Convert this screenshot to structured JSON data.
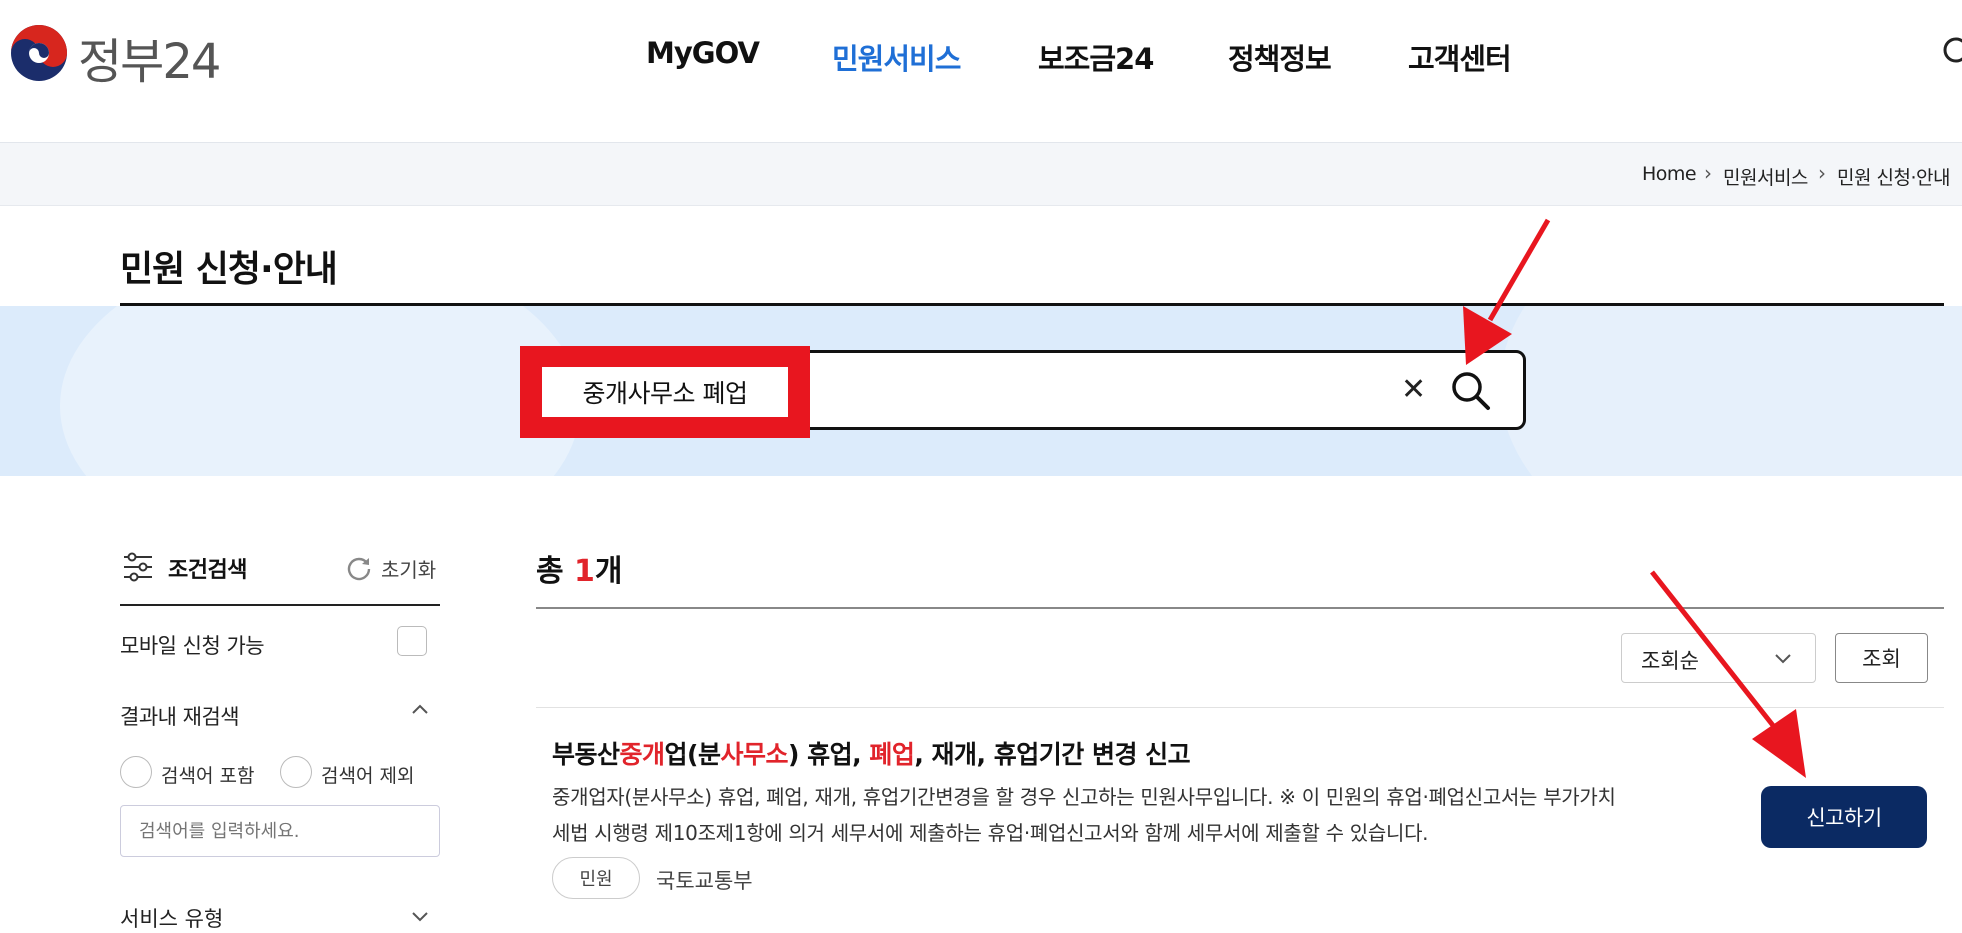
{
  "header": {
    "logo_text": "정부24",
    "nav": [
      "MyGOV",
      "민원서비스",
      "보조금24",
      "정책정보",
      "고객센터"
    ],
    "active_nav": "민원서비스"
  },
  "breadcrumb": [
    "Home",
    "민원서비스",
    "민원 신청·안내"
  ],
  "page_title": "민원 신청·안내",
  "search": {
    "query": "중개사무소 폐업",
    "clear_symbol": "✕"
  },
  "sidebar": {
    "filter_title": "조건검색",
    "reset_label": "초기화",
    "mobile_label": "모바일 신청 가능",
    "refine_label": "결과내 재검색",
    "include_label": "검색어 포함",
    "exclude_label": "검색어 제외",
    "refine_placeholder": "검색어를 입력하세요.",
    "service_type_label": "서비스 유형"
  },
  "results": {
    "total_prefix": "총 ",
    "total_count": "1",
    "total_suffix": "개",
    "sort_value": "조회순",
    "query_button": "조회",
    "item": {
      "title_parts": [
        "부동산",
        "중개",
        "업(분",
        "사무소",
        ") 휴업, ",
        "폐업",
        ", 재개, 휴업기간 변경 신고"
      ],
      "desc_line1": "중개업자(분사무소) 휴업, 폐업, 재개, 휴업기간변경을 할 경우 신고하는 민원사무입니다. ※ 이 민원의 휴업·폐업신고서는 부가가치",
      "desc_line2": "세법 시행령 제10조제1항에 의거 세무서에 제출하는 휴업·폐업신고서와 함께 세무서에 제출할 수 있습니다.",
      "tag": "민원",
      "agency": "국토교통부",
      "action_button": "신고하기"
    }
  },
  "colors": {
    "active_nav": "#1f6fd6",
    "highlight": "#e1242b",
    "action_button": "#0b2a63",
    "annotation": "#e8161f",
    "search_band": "#dcebfb"
  },
  "icons": [
    "gov-emblem-icon",
    "header-search-icon",
    "clear-icon",
    "search-icon",
    "filter-icon",
    "reset-icon",
    "chevron-up-icon",
    "chevron-down-icon",
    "annotation-arrow-icon"
  ]
}
